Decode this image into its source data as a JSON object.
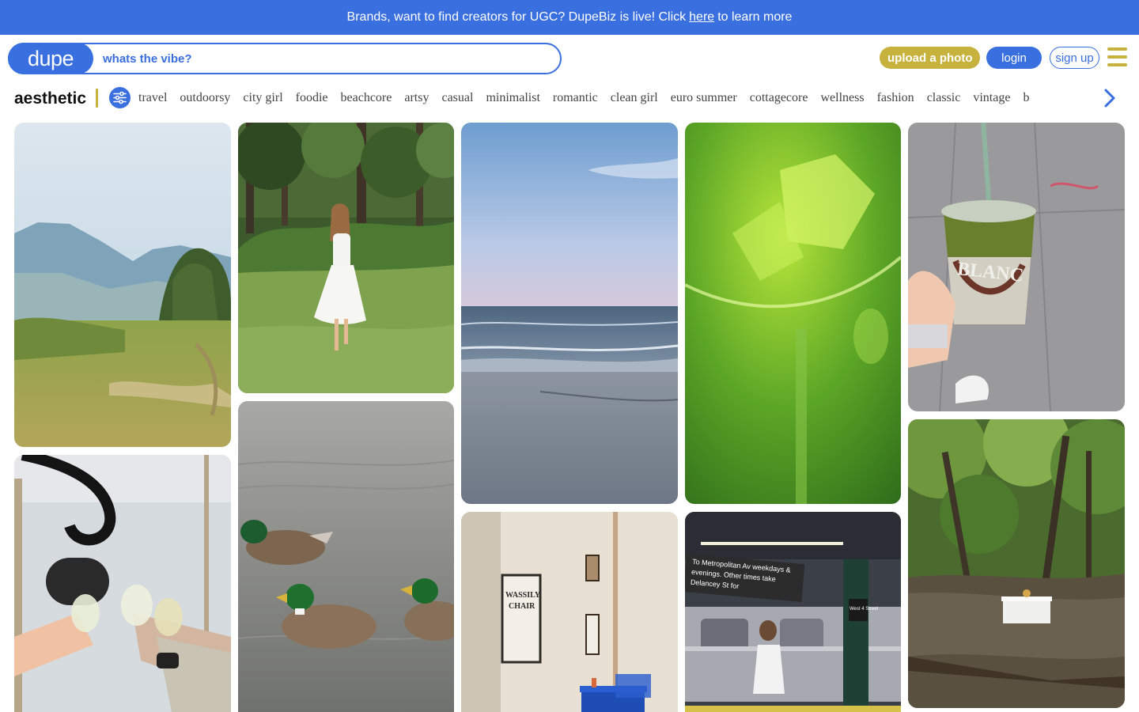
{
  "banner": {
    "text_before": "Brands, want to find creators for UGC? DupeBiz is live! Click",
    "link": "here",
    "text_after": "to learn more"
  },
  "header": {
    "logo": "dupe",
    "search_placeholder": "whats the vibe?",
    "upload_label": "upload a photo",
    "login_label": "login",
    "signup_label": "sign up"
  },
  "categories": {
    "title": "aesthetic",
    "items": [
      "travel",
      "outdoorsy",
      "city girl",
      "foodie",
      "beachcore",
      "artsy",
      "casual",
      "minimalist",
      "romantic",
      "clean girl",
      "euro summer",
      "cottagecore",
      "wellness",
      "fashion",
      "classic",
      "vintage",
      "b"
    ]
  },
  "colors": {
    "brand_blue": "#3a6fe0",
    "accent_gold": "#c6b23c"
  },
  "photos": [
    {
      "name": "mountain-meadow",
      "depicts": "mountains-field-trees"
    },
    {
      "name": "white-dress-forest",
      "depicts": "woman-white-dress-grass"
    },
    {
      "name": "beach-shore",
      "depicts": "ocean-waves-sand"
    },
    {
      "name": "green-juice",
      "depicts": "green-drink-ice"
    },
    {
      "name": "matcha-cup",
      "depicts": "hand-holding-iced-matcha"
    },
    {
      "name": "wine-toast",
      "depicts": "hands-clinking-wine-glasses"
    },
    {
      "name": "ducks-pond",
      "depicts": "mallard-ducks-water"
    },
    {
      "name": "wassily-chair-room",
      "depicts": "gallery-room-blue-table"
    },
    {
      "name": "subway-platform",
      "depicts": "woman-subway-station"
    },
    {
      "name": "creek-picnic",
      "depicts": "forest-creek-picnic-table"
    }
  ],
  "subway_sign": {
    "line1": "To Metropolitan Av weekdays &",
    "line2": "evenings. Other times take",
    "line3": "Delancey St for",
    "station": "West 4 Street"
  },
  "chair_poster": {
    "line1": "WASSILY",
    "line2": "CHAIR"
  },
  "cup_print": "BLANC"
}
